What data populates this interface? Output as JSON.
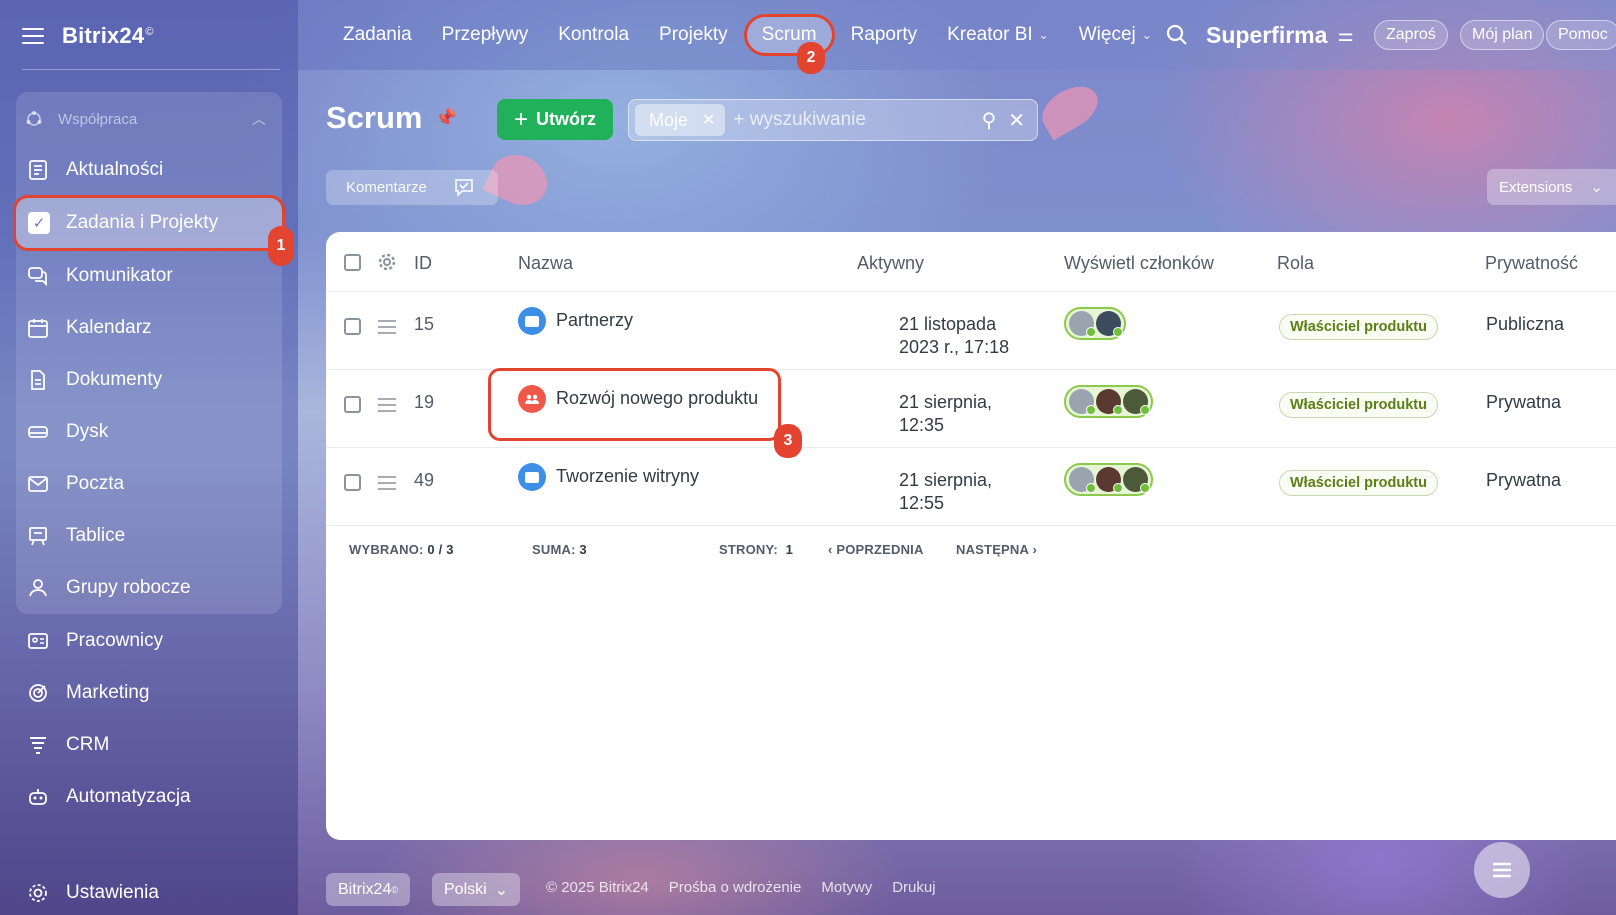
{
  "brand": {
    "name": "Bitrix24",
    "mark": "©"
  },
  "sidebar": {
    "group_label": "Współpraca",
    "items": [
      {
        "label": "Aktualności"
      },
      {
        "label": "Zadania i Projekty"
      },
      {
        "label": "Komunikator"
      },
      {
        "label": "Kalendarz"
      },
      {
        "label": "Dokumenty"
      },
      {
        "label": "Dysk"
      },
      {
        "label": "Poczta"
      },
      {
        "label": "Tablice"
      },
      {
        "label": "Grupy robocze"
      },
      {
        "label": "Pracownicy"
      },
      {
        "label": "Marketing"
      },
      {
        "label": "CRM"
      },
      {
        "label": "Automatyzacja"
      },
      {
        "label": "Ustawienia"
      }
    ]
  },
  "topnav": {
    "items": [
      {
        "label": "Zadania"
      },
      {
        "label": "Przepływy"
      },
      {
        "label": "Kontrola"
      },
      {
        "label": "Projekty"
      },
      {
        "label": "Scrum"
      },
      {
        "label": "Raporty"
      },
      {
        "label": "Kreator BI"
      },
      {
        "label": "Więcej"
      }
    ],
    "company": "Superfirma",
    "invite": "Zaproś",
    "plan": "Mój plan",
    "help": "Pomoc"
  },
  "annotations": {
    "one": "1",
    "two": "2",
    "three": "3"
  },
  "page": {
    "title": "Scrum",
    "create_label": "Utwórz",
    "filter_chip": "Moje",
    "search_placeholder": "+ wyszukiwanie",
    "comments_label": "Komentarze",
    "extensions_label": "Extensions"
  },
  "table": {
    "headers": {
      "id": "ID",
      "name": "Nazwa",
      "active": "Aktywny",
      "members": "Wyświetl członków",
      "role": "Rola",
      "privacy": "Prywatność"
    },
    "rows": [
      {
        "id": "15",
        "name": "Partnerzy",
        "date": "21 listopada 2023 r., 17:18",
        "role": "Właściciel produktu",
        "privacy": "Publiczna"
      },
      {
        "id": "19",
        "name": "Rozwój nowego produktu",
        "date": "21 sierpnia, 12:35",
        "role": "Właściciel produktu",
        "privacy": "Prywatna"
      },
      {
        "id": "49",
        "name": "Tworzenie witryny",
        "date": "21 sierpnia, 12:55",
        "role": "Właściciel produktu",
        "privacy": "Prywatna"
      }
    ],
    "footer": {
      "selected_label": "WYBRANO:",
      "selected_value": "0 / 3",
      "total_label": "SUMA:",
      "total_value": "3",
      "pages_label": "STRONY:",
      "pages_value": "1",
      "prev": "POPRZEDNIA",
      "next": "NASTĘPNA"
    }
  },
  "bottom": {
    "brand": "Bitrix24",
    "brand_mark": "©",
    "language": "Polski",
    "copyright": "© 2025 Bitrix24",
    "request": "Prośba o wdrożenie",
    "themes": "Motywy",
    "print": "Drukuj"
  },
  "colors": {
    "accent_green": "#21b15a",
    "annotation_red": "#e2442f",
    "role_text": "#5a7f14",
    "project_blue": "#3d8ee6",
    "group_red": "#f0584a"
  }
}
